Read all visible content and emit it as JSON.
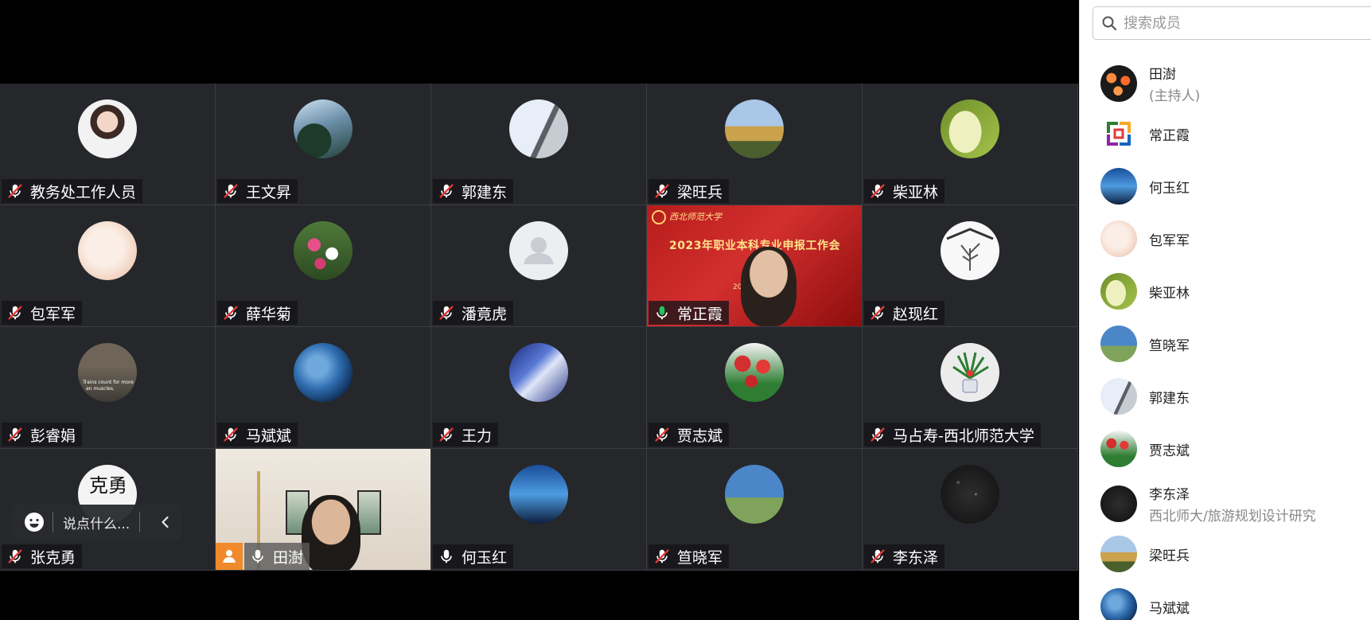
{
  "grid": {
    "tiles": [
      {
        "name": "教务处工作人员",
        "mic": "muted"
      },
      {
        "name": "王文昇",
        "mic": "muted"
      },
      {
        "name": "郭建东",
        "mic": "muted"
      },
      {
        "name": "梁旺兵",
        "mic": "muted"
      },
      {
        "name": "柴亚林",
        "mic": "muted"
      },
      {
        "name": "包军军",
        "mic": "muted"
      },
      {
        "name": "薛华菊",
        "mic": "muted"
      },
      {
        "name": "潘竟虎",
        "mic": "muted"
      },
      {
        "name": "常正霞",
        "mic": "speaking",
        "video": true
      },
      {
        "name": "赵现红",
        "mic": "muted"
      },
      {
        "name": "彭睿娟",
        "mic": "muted"
      },
      {
        "name": "马斌斌",
        "mic": "muted"
      },
      {
        "name": "王力",
        "mic": "muted"
      },
      {
        "name": "贾志斌",
        "mic": "muted"
      },
      {
        "name": "马占寿-西北师范大学",
        "mic": "muted"
      },
      {
        "name": "张克勇",
        "mic": "muted"
      },
      {
        "name": "田澍",
        "mic": "on",
        "video": true,
        "host": true
      },
      {
        "name": "何玉红",
        "mic": "on"
      },
      {
        "name": "笪晓军",
        "mic": "muted"
      },
      {
        "name": "李东泽",
        "mic": "muted"
      }
    ],
    "banner": {
      "university": "西北师范大学",
      "title": "2023年职业本科专业申报工作会",
      "date_fragment": "2023"
    },
    "avatar_texts": {
      "peng_caption_1": "Trains count for more",
      "peng_caption_2": "an muscles.",
      "zhang_calligraphy": "克勇"
    }
  },
  "chat": {
    "placeholder": "说点什么...",
    "icon_emoji": "smiley-icon",
    "icon_collapse": "chevron-left-icon"
  },
  "panel": {
    "search_placeholder": "搜索成员",
    "members": [
      {
        "name": "田澍",
        "sub": "(主持人)"
      },
      {
        "name": "常正霞"
      },
      {
        "name": "何玉红"
      },
      {
        "name": "包军军"
      },
      {
        "name": "柴亚林"
      },
      {
        "name": "笪晓军"
      },
      {
        "name": "郭建东"
      },
      {
        "name": "贾志斌"
      },
      {
        "name": "李东泽",
        "sub": "西北师大/旅游规划设计研究"
      },
      {
        "name": "梁旺兵"
      },
      {
        "name": "马斌斌"
      }
    ]
  },
  "colors": {
    "tile_bg": "#25272b",
    "muted_mic": "#e53935",
    "speaking_mic": "#22c55e",
    "host_badge": "#f08a2d",
    "panel_bg": "#ffffff"
  }
}
